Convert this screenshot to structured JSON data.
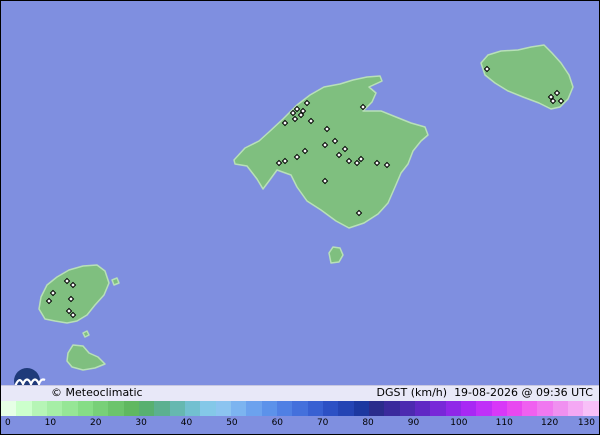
{
  "map": {
    "sea_color": "#7f8fe0",
    "land_color": "#7fbf7f",
    "coast_color": "#b8e0b8",
    "station_marker": "diamond"
  },
  "footer": {
    "logo": "meteoclimatic-wave-logo",
    "credit": "© Meteoclimatic",
    "variable": "DGST (km/h)",
    "timestamp": "19-08-2026 @ 09:36 UTC",
    "variable_line": "DGST (km/h)   19-08-2026 @ 09:36 UTC"
  },
  "legend": {
    "unit": "km/h",
    "min": 0,
    "max": 130,
    "tick_labels": [
      "0",
      "10",
      "20",
      "30",
      "40",
      "50",
      "60",
      "70",
      "80",
      "90",
      "100",
      "110",
      "120",
      "130"
    ],
    "colors": [
      "#e6ffe6",
      "#ccffcc",
      "#b6f5b6",
      "#a6eea6",
      "#96e696",
      "#86dd86",
      "#78d078",
      "#6cc46c",
      "#60b860",
      "#58b070",
      "#5cb090",
      "#66b8b0",
      "#72c0d0",
      "#84c8e8",
      "#8cc4f0",
      "#7cb4f0",
      "#6ca2ee",
      "#5c92ea",
      "#5080e4",
      "#4470dc",
      "#3860d2",
      "#2c50c4",
      "#2444b4",
      "#1c38a0",
      "#2a2c8c",
      "#3a2a9c",
      "#4c2ab0",
      "#6028c4",
      "#7828d8",
      "#9028e8",
      "#a828f4",
      "#c030f8",
      "#d838f8",
      "#e848f0",
      "#f060f0",
      "#f078f0",
      "#f090f0",
      "#f4a8f4",
      "#f8c0f8"
    ]
  }
}
